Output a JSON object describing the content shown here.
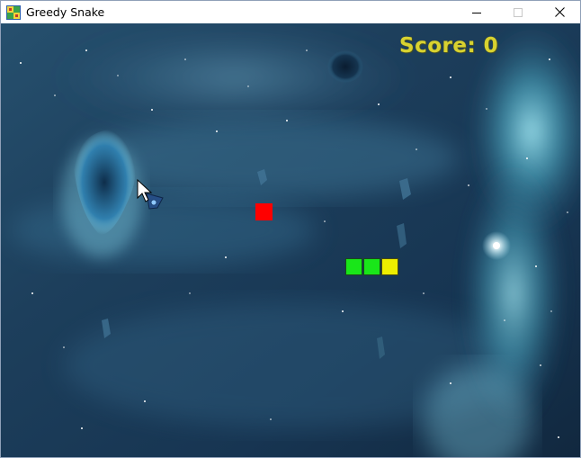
{
  "window": {
    "title": "Greedy Snake",
    "icons": {
      "app": "snake-app-icon",
      "minimize": "minimize-icon",
      "maximize": "maximize-icon",
      "close": "close-icon"
    }
  },
  "game": {
    "score_text": "Score: 0",
    "score": 0,
    "colors": {
      "score": "#d8d230",
      "food": "#ff0000",
      "snake_body": "#19e619",
      "snake_head": "#eeee00"
    },
    "snake": {
      "length": 3,
      "direction": "right"
    }
  }
}
